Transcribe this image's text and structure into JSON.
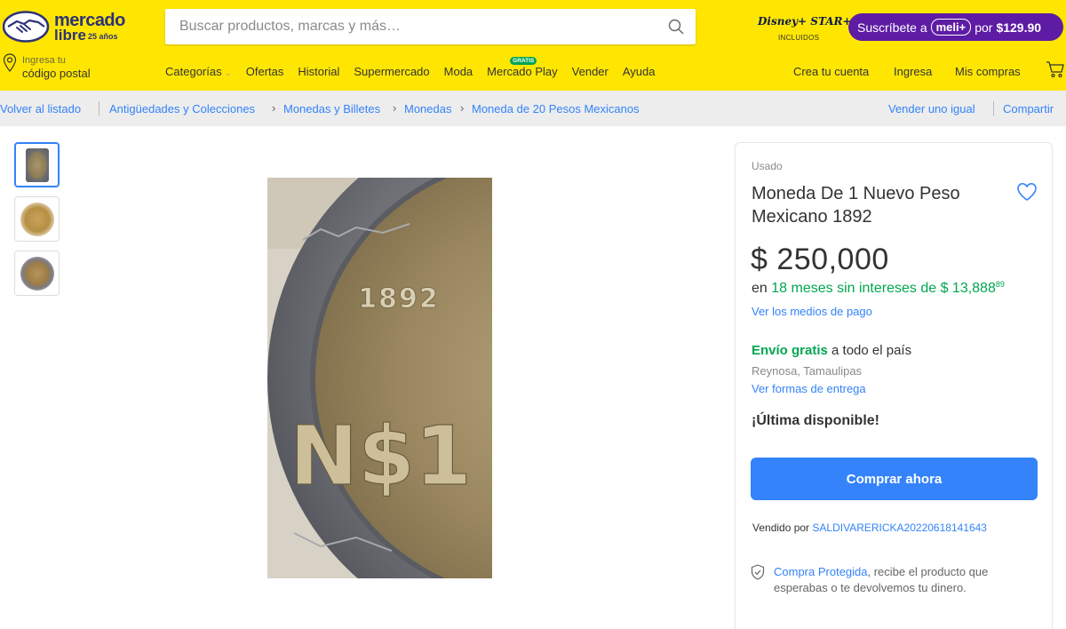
{
  "header": {
    "logo": {
      "line1": "mercado",
      "line2": "libre",
      "anniversary": "25 años"
    },
    "search": {
      "placeholder": "Buscar productos, marcas y más…",
      "value": ""
    },
    "disney": {
      "brand": "Disney+ STAR+",
      "sub": "INCLUIDOS"
    },
    "subscribe": {
      "prefix": "Suscríbete a",
      "badge": "meli+",
      "mid": "por",
      "price": "$129.90"
    },
    "postal": {
      "line1": "Ingresa tu",
      "line2": "código postal"
    },
    "nav": [
      {
        "label": "Categorías"
      },
      {
        "label": "Ofertas"
      },
      {
        "label": "Historial"
      },
      {
        "label": "Supermercado"
      },
      {
        "label": "Moda"
      },
      {
        "label": "Mercado Play",
        "badge": "GRATIS"
      },
      {
        "label": "Vender"
      },
      {
        "label": "Ayuda"
      }
    ],
    "user_nav": [
      {
        "label": "Crea tu cuenta"
      },
      {
        "label": "Ingresa"
      },
      {
        "label": "Mis compras"
      }
    ]
  },
  "breadcrumb": {
    "back": "Volver al listado",
    "items": [
      "Antigüedades y Colecciones",
      "Monedas y Billetes",
      "Monedas",
      "Moneda de 20 Pesos Mexicanos"
    ],
    "sell_same": "Vender uno igual",
    "share": "Compartir"
  },
  "product": {
    "condition": "Usado",
    "title": "Moneda De 1 Nuevo Peso Mexicano 1892",
    "price": "$ 250,000",
    "installments": {
      "prefix": "en",
      "highlight": "18 meses sin intereses de $ 13,888",
      "cents": "89"
    },
    "payment_link": "Ver los medios de pago",
    "shipping": {
      "free": "Envío gratis",
      "rest": " a todo el país"
    },
    "location": "Reynosa, Tamaulipas",
    "delivery_link": "Ver formas de entrega",
    "stock": "¡Última disponible!",
    "buy_label": "Comprar ahora",
    "seller": {
      "prefix": "Vendido por",
      "name": "SALDIVARERICKA20220618141643"
    },
    "protection": {
      "link": "Compra Protegida",
      "text": ", recibe el producto que esperabas o te devolvemos tu dinero."
    },
    "coin_year": "1892",
    "coin_symbol": "N$1"
  },
  "colors": {
    "header_bg": "#ffe600",
    "accent_blue": "#3483fa",
    "green": "#00a650",
    "meli_purple": "#5e1ca4"
  }
}
